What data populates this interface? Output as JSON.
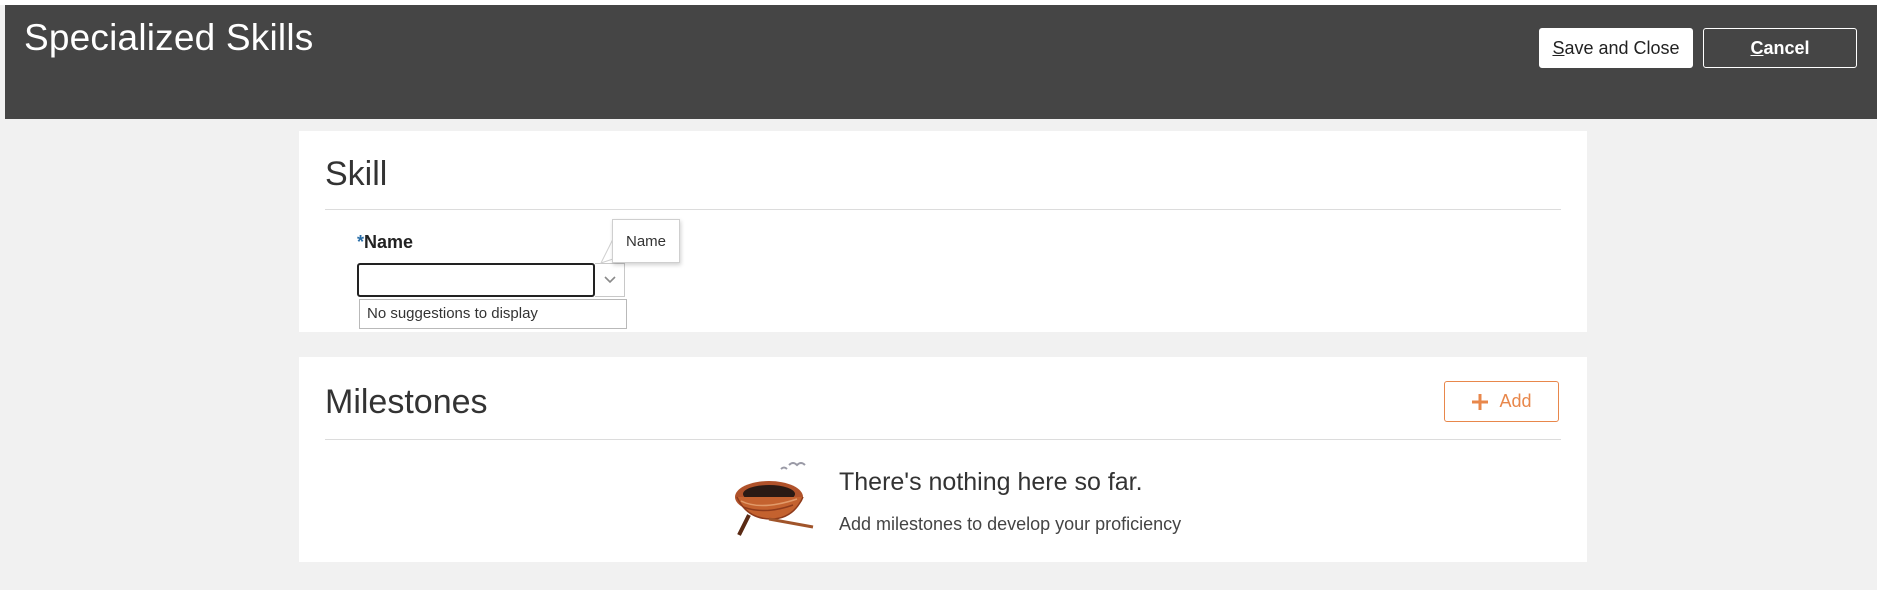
{
  "header": {
    "title": "Specialized Skills",
    "save_label_mnemonic": "S",
    "save_label_rest": "ave and Close",
    "cancel_label_mnemonic": "C",
    "cancel_label_rest": "ancel"
  },
  "skill_section": {
    "title": "Skill",
    "name_field": {
      "required_mark": "*",
      "label": "Name",
      "value": "",
      "suggestions_message": "No suggestions to display",
      "tooltip": "Name"
    }
  },
  "milestones_section": {
    "title": "Milestones",
    "add_label": "Add",
    "empty_title": "There's nothing here so far.",
    "empty_message": "Add milestones to develop your proficiency"
  },
  "colors": {
    "header_bg": "#454545",
    "page_bg": "#f1f1f1",
    "accent_orange": "#e8874b",
    "required_blue": "#2a6ea8"
  },
  "icons": {
    "dropdown": "chevron-down-icon",
    "add": "plus-icon",
    "empty_state": "bird-nest-icon"
  }
}
